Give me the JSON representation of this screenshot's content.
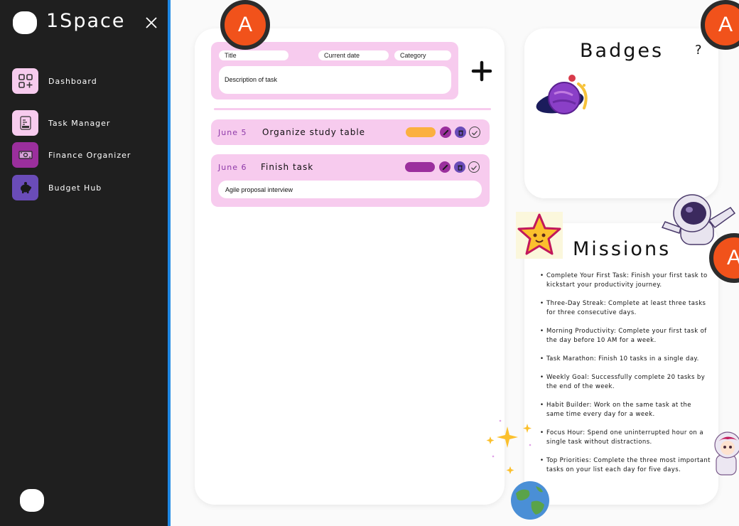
{
  "app": {
    "title": "1Space"
  },
  "sidebar": {
    "items": [
      {
        "label": "Dashboard",
        "icon": "dashboard-icon",
        "color": "#f7cbee"
      },
      {
        "label": "Task Manager",
        "icon": "task-list-icon",
        "color": "#f7cbee"
      },
      {
        "label": "Finance Organizer",
        "icon": "money-icon",
        "color": "#9b2f9d"
      },
      {
        "label": "Budget Hub",
        "icon": "piggy-bank-icon",
        "color": "#6a4cb8"
      }
    ]
  },
  "avatar": {
    "initial": "A",
    "color": "#f1521b"
  },
  "task_form": {
    "title_placeholder": "Title",
    "date_placeholder": "Current date",
    "category_placeholder": "Category",
    "description_placeholder": "Description of task"
  },
  "tasks": [
    {
      "date": "June 5",
      "name": "Organize study table",
      "category_color": "#fbb040"
    },
    {
      "date": "June 6",
      "name": "Finish task",
      "category_color": "#9b2f9d",
      "subtask": "Agile proposal interview"
    }
  ],
  "badges": {
    "title": "Badges",
    "help": "?"
  },
  "missions": {
    "title": "Missions",
    "items": [
      "Complete Your First Task: Finish your first task to kickstart your productivity journey.",
      "Three-Day Streak: Complete at least three tasks for three consecutive days.",
      "Morning Productivity: Complete your first task of the day before 10 AM for a week.",
      "Task Marathon: Finish 10 tasks in a single day.",
      "Weekly Goal: Successfully complete 20 tasks by the end of the week.",
      "Habit Builder: Work on the same task at the same time every day for a week.",
      "Focus Hour: Spend one uninterrupted hour on a single task without distractions.",
      "Top Priorities: Complete the three most important tasks on your list each day for five days."
    ]
  },
  "colors": {
    "accent": "#1e88e5",
    "pink": "#f7cbee",
    "purple": "#9b2f9d",
    "sidebar_bg": "#1f1f1f"
  }
}
